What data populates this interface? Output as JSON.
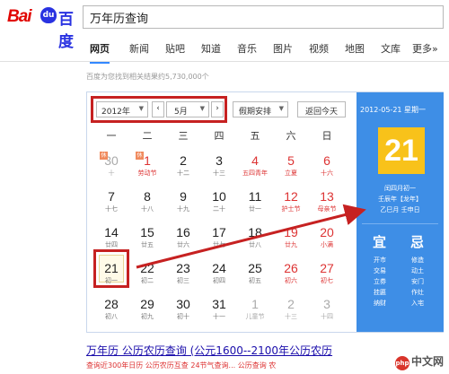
{
  "logo": {
    "bai": "Bai",
    "paw": "du",
    "du": "百度"
  },
  "search": {
    "query": "万年历查询"
  },
  "nav": [
    "网页",
    "新闻",
    "贴吧",
    "知道",
    "音乐",
    "图片",
    "视频",
    "地图",
    "文库",
    "更多»"
  ],
  "result_count": "百度为您找到相关结果约5,730,000个",
  "calendar": {
    "year": "2012年",
    "month": "5月",
    "holiday": "假期安排",
    "today": "返回今天",
    "weekdays": [
      "一",
      "二",
      "三",
      "四",
      "五",
      "六",
      "日"
    ],
    "weeks": [
      [
        [
          "30",
          "十",
          "gray"
        ],
        [
          "1",
          "劳动节",
          "red"
        ],
        [
          "2",
          "十二",
          ""
        ],
        [
          "3",
          "十三",
          ""
        ],
        [
          "4",
          "五四青年",
          "red"
        ],
        [
          "5",
          "立夏",
          "red"
        ],
        [
          "6",
          "十六",
          "red"
        ]
      ],
      [
        [
          "7",
          "十七",
          ""
        ],
        [
          "8",
          "十八",
          ""
        ],
        [
          "9",
          "十九",
          ""
        ],
        [
          "10",
          "二十",
          ""
        ],
        [
          "11",
          "廿一",
          ""
        ],
        [
          "12",
          "护士节",
          "red"
        ],
        [
          "13",
          "母亲节",
          "red"
        ]
      ],
      [
        [
          "14",
          "廿四",
          ""
        ],
        [
          "15",
          "廿五",
          ""
        ],
        [
          "16",
          "廿六",
          ""
        ],
        [
          "17",
          "廿七",
          ""
        ],
        [
          "18",
          "廿八",
          ""
        ],
        [
          "19",
          "廿九",
          "red"
        ],
        [
          "20",
          "小满",
          "red"
        ]
      ],
      [
        [
          "21",
          "初一",
          ""
        ],
        [
          "22",
          "初二",
          ""
        ],
        [
          "23",
          "初三",
          ""
        ],
        [
          "24",
          "初四",
          ""
        ],
        [
          "25",
          "初五",
          ""
        ],
        [
          "26",
          "初六",
          "red"
        ],
        [
          "27",
          "初七",
          "red"
        ]
      ],
      [
        [
          "28",
          "初八",
          ""
        ],
        [
          "29",
          "初九",
          ""
        ],
        [
          "30",
          "初十",
          ""
        ],
        [
          "31",
          "十一",
          ""
        ],
        [
          "1",
          "儿童节",
          "gray"
        ],
        [
          "2",
          "十三",
          "gray"
        ],
        [
          "3",
          "十四",
          "gray"
        ]
      ]
    ],
    "badges": {
      "holiday": "休",
      "work": "班"
    },
    "side": {
      "date": "2012-05-21 星期一",
      "day": "21",
      "lunar1": "闰四月初一",
      "lunar2": "壬辰年【龙年】",
      "lunar3": "乙巳月 壬申日",
      "yi": "宜",
      "ji": "忌",
      "yi_items": [
        "开市",
        "交易",
        "立券",
        "挂匾",
        "纳财"
      ],
      "ji_items": [
        "修造",
        "动土",
        "安门",
        "作灶",
        "入宅"
      ]
    }
  },
  "result": {
    "title": "万年历 公历农历查询 (公元1600--2100年公历农历",
    "desc": "查询近300年日历 公历农历互查 24节气查询... 公历查询 农"
  },
  "watermark": {
    "mark": "php",
    "text": "中文网"
  },
  "colors": {
    "accent": "#3e8ee6",
    "highlight": "#f8c21a",
    "annotation": "#c62121"
  }
}
